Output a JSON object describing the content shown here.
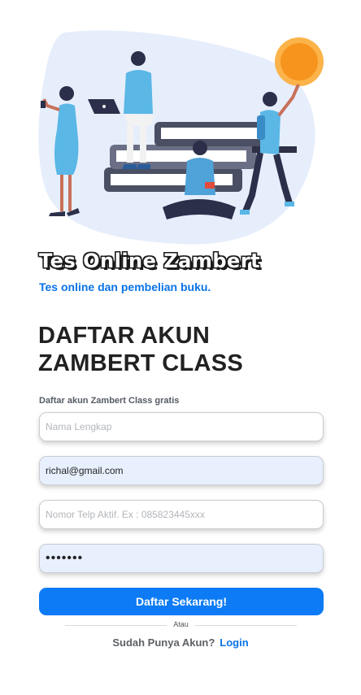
{
  "brand": {
    "title": "Tes Online Zambert",
    "tagline": "Tes online dan pembelian buku."
  },
  "register": {
    "heading_line1": "DAFTAR AKUN",
    "heading_line2": "ZAMBERT CLASS",
    "subtitle": "Daftar akun Zambert Class gratis"
  },
  "form": {
    "name_placeholder": "Nama Lengkap",
    "name_value": "",
    "email_value": "richal@gmail.com",
    "phone_placeholder": "Nomor Telp Aktif. Ex : 085823445xxx",
    "phone_value": "",
    "password_value": "1234567",
    "submit_label": "Daftar Sekarang!"
  },
  "footer": {
    "or_label": "Atau",
    "question": "Sudah Punya Akun?",
    "login_link": "Login"
  },
  "colors": {
    "accent": "#0d7bf5",
    "link": "#0a73e8",
    "autofill": "#e8f0fe",
    "sun": "#f7941d",
    "blob": "#e6eefc"
  },
  "illustration": {
    "name": "people-reading-books-illustration"
  }
}
